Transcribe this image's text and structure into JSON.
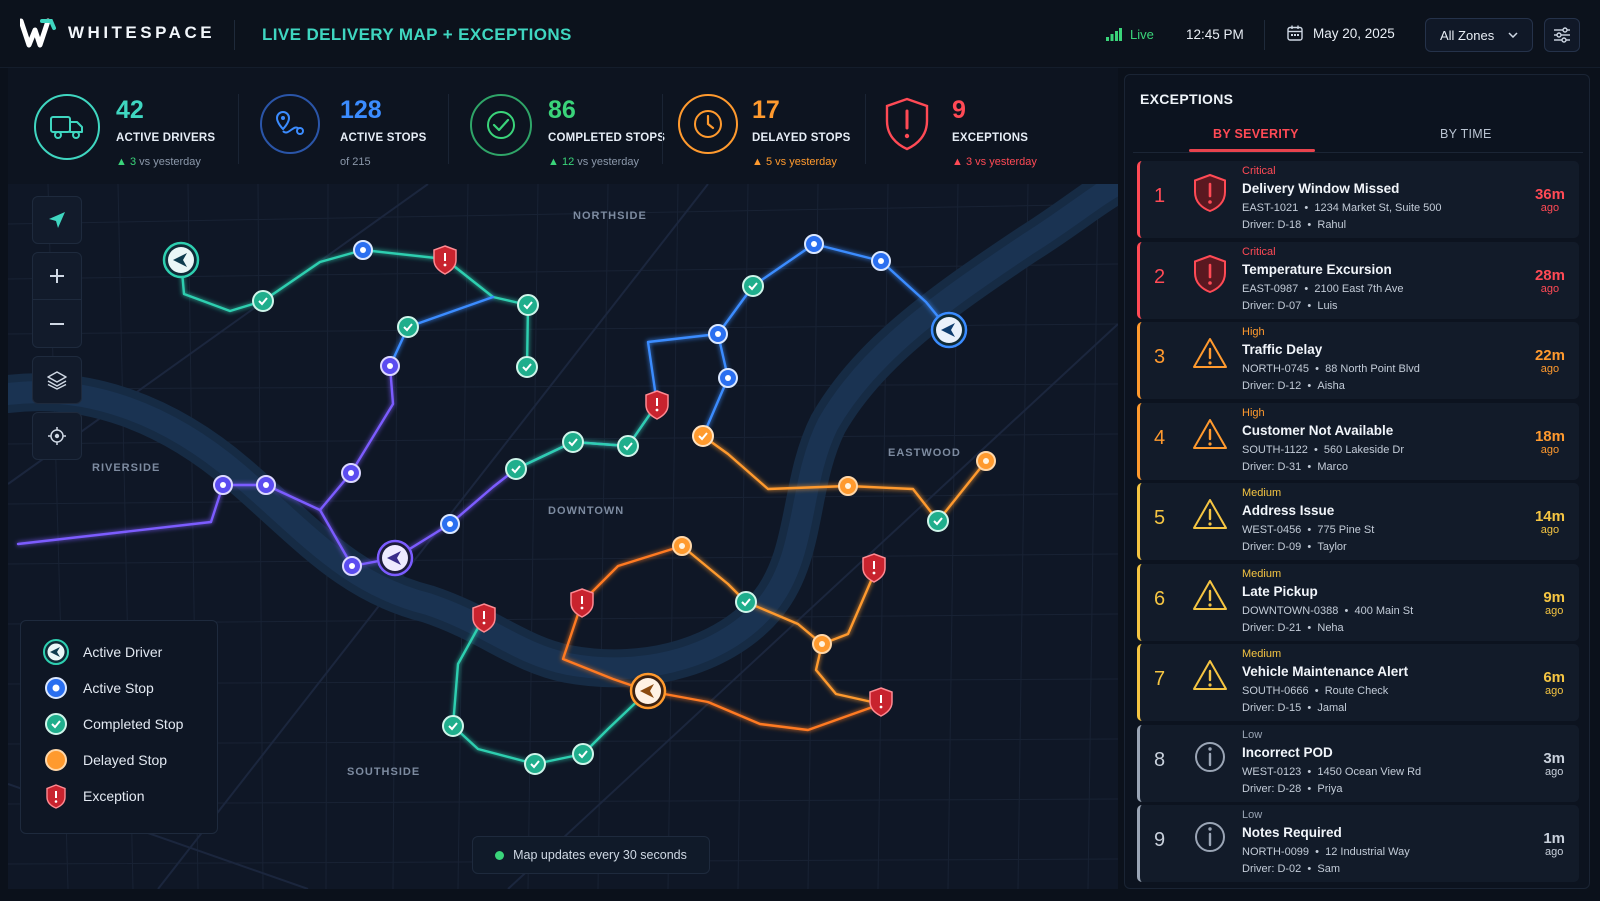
{
  "header": {
    "brand": "WHITESPACE",
    "title": "LIVE DELIVERY MAP + EXCEPTIONS",
    "live_label": "Live",
    "time": "12:45 PM",
    "date": "May 20, 2025",
    "zone_select": "All Zones"
  },
  "stats": [
    {
      "value": "42",
      "label": "ACTIVE DRIVERS",
      "arrow": "▲",
      "delta": "3",
      "sub": "vs yesterday",
      "color": "#3fd6c0",
      "icon": "truck-icon"
    },
    {
      "value": "128",
      "label": "ACTIVE STOPS",
      "arrow": "",
      "delta": "",
      "sub": "of 215",
      "color": "#3b8cff",
      "icon": "route-pin-icon"
    },
    {
      "value": "86",
      "label": "COMPLETED STOPS",
      "arrow": "▲",
      "delta": "12",
      "sub": "vs yesterday",
      "color": "#3ad47a",
      "icon": "check-circle-icon"
    },
    {
      "value": "17",
      "label": "DELAYED STOPS",
      "arrow": "▲",
      "delta": "5",
      "sub": "vs yesterday",
      "color": "#ff9a2e",
      "icon": "clock-icon"
    },
    {
      "value": "9",
      "label": "EXCEPTIONS",
      "arrow": "▲",
      "delta": "3",
      "sub": "vs yesterday",
      "color": "#ff4a55",
      "icon": "shield-alert-icon"
    }
  ],
  "map": {
    "areas": {
      "northside": "NORTHSIDE",
      "riverside": "RIVERSIDE",
      "eastwood": "EASTWOOD",
      "downtown": "DOWNTOWN",
      "southside": "SOUTHSIDE"
    },
    "update_note": "Map updates every 30 seconds"
  },
  "legend": {
    "active_driver": "Active Driver",
    "active_stop": "Active Stop",
    "completed_stop": "Completed Stop",
    "delayed_stop": "Delayed Stop",
    "exception": "Exception"
  },
  "exceptions": {
    "title": "EXCEPTIONS",
    "tabs": [
      "BY SEVERITY",
      "BY TIME"
    ],
    "items": [
      {
        "num": "1",
        "severity": "Critical",
        "title": "Delivery Window Missed",
        "id": "EAST-1021",
        "location": "1234 Market St, Suite 500",
        "driver": "Driver: D-18",
        "name": "Rahul",
        "ago": "36m",
        "ago_label": "ago",
        "color": "#ff4a55",
        "icon": "shield-alert-icon"
      },
      {
        "num": "2",
        "severity": "Critical",
        "title": "Temperature Excursion",
        "id": "EAST-0987",
        "location": "2100 East 7th Ave",
        "driver": "Driver: D-07",
        "name": "Luis",
        "ago": "28m",
        "ago_label": "ago",
        "color": "#ff4a55",
        "icon": "shield-alert-icon"
      },
      {
        "num": "3",
        "severity": "High",
        "title": "Traffic Delay",
        "id": "NORTH-0745",
        "location": "88 North Point Blvd",
        "driver": "Driver: D-12",
        "name": "Aisha",
        "ago": "22m",
        "ago_label": "ago",
        "color": "#ff9a2e",
        "icon": "warning-triangle-icon"
      },
      {
        "num": "4",
        "severity": "High",
        "title": "Customer Not Available",
        "id": "SOUTH-1122",
        "location": "560 Lakeside Dr",
        "driver": "Driver: D-31",
        "name": "Marco",
        "ago": "18m",
        "ago_label": "ago",
        "color": "#ff9a2e",
        "icon": "warning-triangle-icon"
      },
      {
        "num": "5",
        "severity": "Medium",
        "title": "Address Issue",
        "id": "WEST-0456",
        "location": "775 Pine St",
        "driver": "Driver: D-09",
        "name": "Taylor",
        "ago": "14m",
        "ago_label": "ago",
        "color": "#f5c542",
        "icon": "warning-triangle-icon"
      },
      {
        "num": "6",
        "severity": "Medium",
        "title": "Late Pickup",
        "id": "DOWNTOWN-0388",
        "location": "400 Main St",
        "driver": "Driver: D-21",
        "name": "Neha",
        "ago": "9m",
        "ago_label": "ago",
        "color": "#f5c542",
        "icon": "warning-triangle-icon"
      },
      {
        "num": "7",
        "severity": "Medium",
        "title": "Vehicle Maintenance Alert",
        "id": "SOUTH-0666",
        "location": "Route Check",
        "driver": "Driver: D-15",
        "name": "Jamal",
        "ago": "6m",
        "ago_label": "ago",
        "color": "#f5c542",
        "icon": "warning-triangle-icon"
      },
      {
        "num": "8",
        "severity": "Low",
        "title": "Incorrect POD",
        "id": "WEST-0123",
        "location": "1450 Ocean View Rd",
        "driver": "Driver: D-28",
        "name": "Priya",
        "ago": "3m",
        "ago_label": "ago",
        "color": "#9aa5b5",
        "icon": "info-circle-icon"
      },
      {
        "num": "9",
        "severity": "Low",
        "title": "Notes Required",
        "id": "NORTH-0099",
        "location": "12 Industrial Way",
        "driver": "Driver: D-02",
        "name": "Sam",
        "ago": "1m",
        "ago_label": "ago",
        "color": "#9aa5b5",
        "icon": "info-circle-icon"
      }
    ]
  },
  "colors": {
    "teal": "#3fd6c0",
    "blue": "#3b8cff",
    "green": "#2fc48f",
    "orange": "#ff9a2e",
    "red": "#ff4a55",
    "purple": "#7b5cff"
  }
}
